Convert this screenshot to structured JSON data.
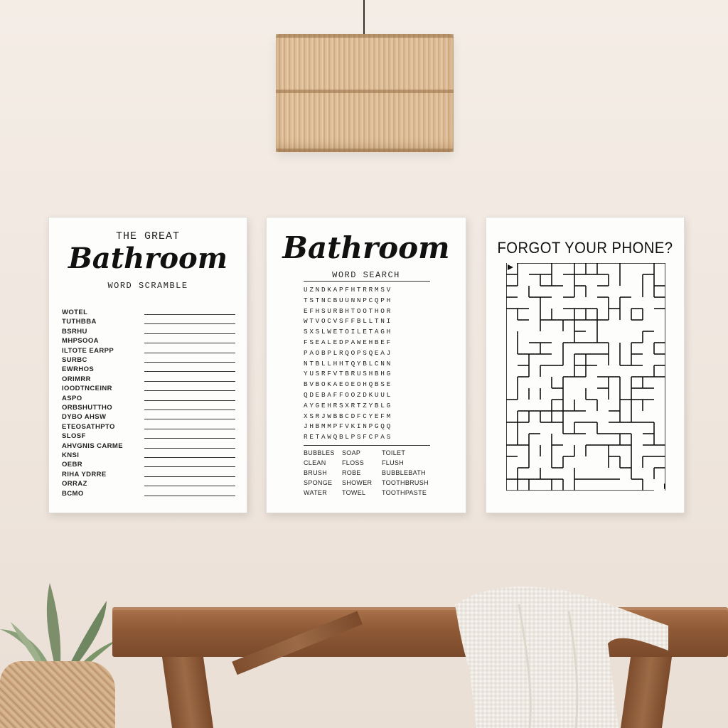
{
  "scene": {
    "description_free": true
  },
  "poster_scramble": {
    "heading_top": "THE GREAT",
    "heading_script": "Bathroom",
    "heading_sub": "WORD SCRAMBLE",
    "words": [
      "WOTEL",
      "TUTHBBA",
      "BSRHU",
      "MHPSOOA",
      "ILTOTE EARPP",
      "SURBC",
      "EWRHOS",
      "ORIMRR",
      "IOODTNCEINR",
      "ASPO",
      "ORBSHUTTHO",
      "DYBO AHSW",
      "ETEOSATHPTO",
      "SLOSF",
      "AHVGNIS CARME",
      "KNSI",
      "OEBR",
      "RIHA YDRRE",
      "ORRAZ",
      "BCMO"
    ]
  },
  "poster_search": {
    "heading_script": "Bathroom",
    "heading_sub": "WORD SEARCH",
    "grid": [
      "UZNDKAPFHTRRMSV",
      "TSTNCBUUNNPCQPH",
      "EFHSURBHTOOTHOR",
      "WTVOCVSFFBLLTNI",
      "SXSLWETOILETAGH",
      "FSEALEDPAWEHBEF",
      "PAOBPLRQOPSQEAJ",
      "NTBLLHHTQYBLCNN",
      "YUSRFVTBRUSHBHG",
      "BVBOKAEOEOHQBSE",
      "QDEBAFFOOZDKUUL",
      "AYGEHRSXRTZYBLG",
      "XSRJWBBCDFCYEFM",
      "JHBMMPFVKINPGQQ",
      "RETAWQBLPSFCPAS"
    ],
    "words": [
      [
        "BUBBLES",
        "SOAP",
        "TOILET"
      ],
      [
        "CLEAN",
        "FLOSS",
        "FLUSH"
      ],
      [
        "BRUSH",
        "ROBE",
        "BUBBLEBATH"
      ],
      [
        "SPONGE",
        "SHOWER",
        "TOOTHBRUSH"
      ],
      [
        "WATER",
        "TOWEL",
        "TOOTHPASTE"
      ]
    ]
  },
  "poster_maze": {
    "title": "FORGOT YOUR PHONE?"
  },
  "colors": {
    "wall": "#f1e9e1",
    "wood": "#8f5a36",
    "ink": "#111111"
  }
}
